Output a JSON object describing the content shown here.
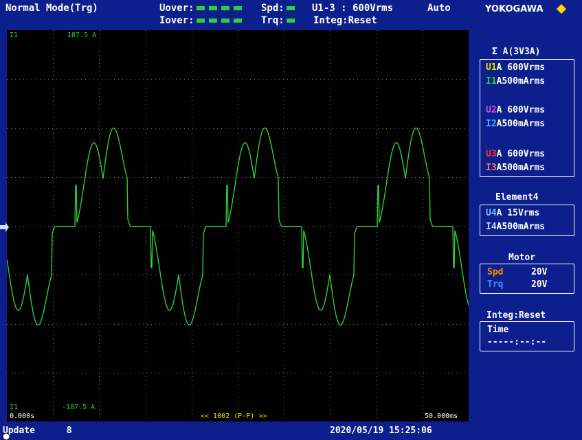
{
  "header": {
    "mode": "Normal Mode(Trg)",
    "uover": "Uover:",
    "iover": "Iover:",
    "spd": "Spd:",
    "trq": "Trq:",
    "range": "U1-3 : 600Vrms",
    "auto": "Auto",
    "integ": "Integ:Reset",
    "brand": "YOKOGAWA"
  },
  "plot": {
    "ch_top": "I1",
    "top_val": "187.5 A",
    "ch_bottom": "I1",
    "bottom_val": "-187.5 A",
    "t_start": "0.000s",
    "t_end": "50.000ms",
    "points": "<< 1002 (P-P) >>",
    "trace_color": "#2ecf3a"
  },
  "side": {
    "sigma_title": "Σ A(3V3A)",
    "u1_ch": "U1",
    "u1_rest": "A 600Vrms",
    "i1_ch": "I1",
    "i1_rest": "A500mArms",
    "u2_ch": "U2",
    "u2_rest": "A 600Vrms",
    "i2_ch": "I2",
    "i2_rest": "A500mArms",
    "u3_ch": "U3",
    "u3_rest": "A 600Vrms",
    "i3_ch": "I3",
    "i3_rest": "A500mArms",
    "element_title": "Element4",
    "u4_ch": "U4",
    "u4_rest": "A  15Vrms",
    "i4_ch": "I4",
    "i4_rest": "A500mArms",
    "motor_title": "Motor",
    "spd_label": "Spd",
    "spd_value": "20V",
    "trq_label": "Trq",
    "trq_value": "20V",
    "integ_title": "Integ:Reset",
    "time_label": "Time",
    "time_value": "-----:--:--"
  },
  "status": {
    "update_label": "Update",
    "update_count": "8",
    "datetime": "2020/05/19 15:25:06"
  }
}
